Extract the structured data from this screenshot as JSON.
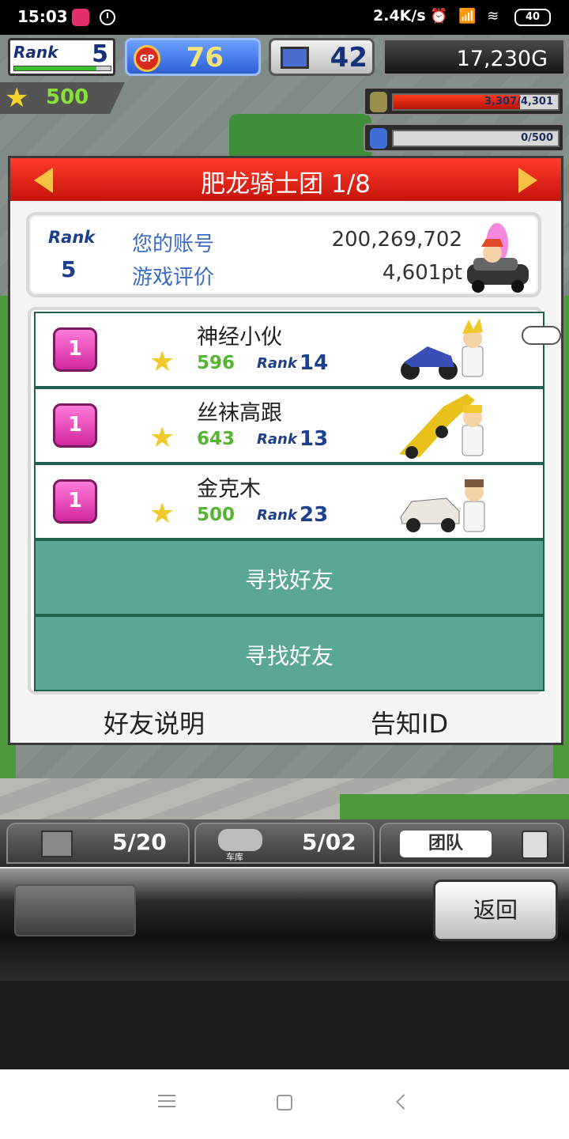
{
  "status_bar": {
    "time": "15:03",
    "net_speed": "2.4K/s",
    "icons": "⏰ 📶 ≋",
    "battery": "40"
  },
  "hud": {
    "rank_label": "Rank",
    "rank_value": "5",
    "rank_progress": 0.85,
    "gp_icon_text": "GP",
    "gp_value": "76",
    "research_value": "42",
    "money": "17,230G",
    "stars": "500",
    "fuel_text": "3,307/4,301",
    "fuel_fraction": 0.77,
    "water_text": "0/500",
    "water_fraction": 0
  },
  "panel": {
    "title": "肥龙骑士团 1/8",
    "account": {
      "rank_label": "Rank",
      "rank_value": "5",
      "id_label": "您的账号",
      "id_value": "200,269,702",
      "rating_label": "游戏评价",
      "rating_value": "4,601pt"
    },
    "friends": [
      {
        "badge": "1",
        "name": "神经小伙",
        "score": "596",
        "rank_label": "Rank",
        "rank": "14"
      },
      {
        "badge": "1",
        "name": "丝袜高跟",
        "score": "643",
        "rank_label": "Rank",
        "rank": "13"
      },
      {
        "badge": "1",
        "name": "金克木",
        "score": "500",
        "rank_label": "Rank",
        "rank": "23"
      }
    ],
    "find_friend_1": "寻找好友",
    "find_friend_2": "寻找好友",
    "footer_left": "好友说明",
    "footer_right": "告知ID"
  },
  "bottom": {
    "seg1_value": "5/20",
    "seg2_value": "5/02",
    "garage_label": "车库",
    "team_label": "团队",
    "back_label": "返回"
  },
  "colors": {
    "panel_header": "#e52516",
    "find_friend_bg": "#5aa797",
    "list_border": "#21614f",
    "accent_text": "#3a6cc4"
  }
}
